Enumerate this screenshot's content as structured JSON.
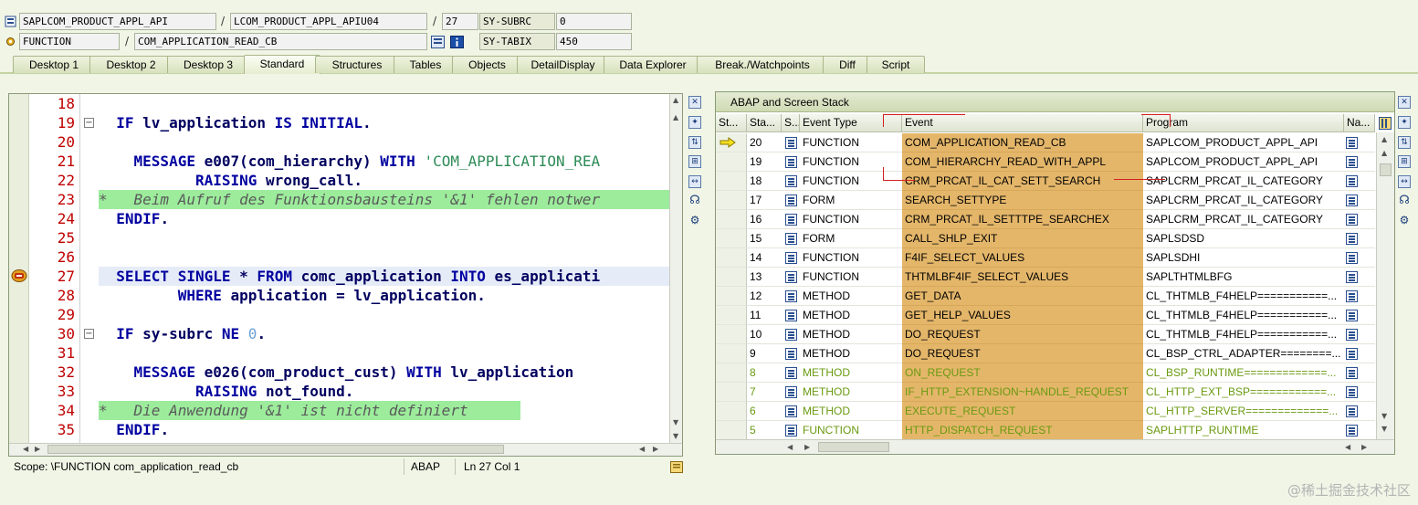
{
  "header": {
    "program": "SAPLCOM_PRODUCT_APPL_API",
    "include": "LCOM_PRODUCT_APPL_APIU04",
    "line": "27",
    "subrc_label": "SY-SUBRC",
    "subrc_value": "0",
    "event_type": "FUNCTION",
    "event": "COM_APPLICATION_READ_CB",
    "tabix_label": "SY-TABIX",
    "tabix_value": "450",
    "slash": "/"
  },
  "tabs": [
    "Desktop 1",
    "Desktop 2",
    "Desktop 3",
    "Standard",
    "Structures",
    "Tables",
    "Objects",
    "DetailDisplay",
    "Data Explorer",
    "Break./Watchpoints",
    "Diff",
    "Script"
  ],
  "active_tab": "Standard",
  "editor": {
    "line_numbers": [
      "18",
      "19",
      "20",
      "21",
      "22",
      "23",
      "24",
      "25",
      "26",
      "27",
      "28",
      "29",
      "30",
      "31",
      "32",
      "33",
      "34",
      "35"
    ],
    "lines": {
      "l19a": "IF",
      "l19b": "lv_application",
      "l19c": "IS INITIAL",
      "l19d": ".",
      "l21a": "MESSAGE",
      "l21b": "e007",
      "l21c": "(com_hierarchy)",
      "l21d": "WITH",
      "l21e": "'COM_APPLICATION_REA",
      "l22a": "RAISING",
      "l22b": "wrong_call",
      "l22c": ".",
      "l23": "*   Beim Aufruf des Funktionsbausteins '&1' fehlen notwer",
      "l24": "ENDIF",
      "l24b": ".",
      "l27a": "SELECT SINGLE",
      "l27b": "*",
      "l27c": "FROM",
      "l27d": "comc_application",
      "l27e": "INTO",
      "l27f": "es_applicati",
      "l28a": "WHERE",
      "l28b": "application",
      "l28c": "=",
      "l28d": "lv_application",
      "l28e": ".",
      "l30a": "IF",
      "l30b": "sy",
      "l30c": "-",
      "l30d": "subrc",
      "l30e": "NE",
      "l30f": "0",
      "l30g": ".",
      "l32a": "MESSAGE",
      "l32b": "e026",
      "l32c": "(com_product_cust)",
      "l32d": "WITH",
      "l32e": "lv_application",
      "l33a": "RAISING",
      "l33b": "not_found",
      "l33c": ".",
      "l34": "*   Die Anwendung '&1' ist nicht definiert",
      "l35": "ENDIF",
      "l35b": "."
    }
  },
  "status_bar": {
    "scope": "Scope: \\FUNCTION com_application_read_cb",
    "language": "ABAP",
    "position": "Ln  27 Col   1"
  },
  "stack": {
    "title": "ABAP and Screen Stack",
    "columns": [
      "St...",
      "Sta...",
      "S...",
      "Event Type",
      "Event",
      "Program",
      "Na..."
    ],
    "rows": [
      {
        "level": "20",
        "type": "FUNCTION",
        "event": "COM_APPLICATION_READ_CB",
        "program": "SAPLCOM_PRODUCT_APPL_API",
        "current": true,
        "dim": false
      },
      {
        "level": "19",
        "type": "FUNCTION",
        "event": "COM_HIERARCHY_READ_WITH_APPL",
        "program": "SAPLCOM_PRODUCT_APPL_API",
        "current": false,
        "dim": false
      },
      {
        "level": "18",
        "type": "FUNCTION",
        "event": "CRM_PRCAT_IL_CAT_SETT_SEARCH",
        "program": "SAPLCRM_PRCAT_IL_CATEGORY",
        "current": false,
        "dim": false
      },
      {
        "level": "17",
        "type": "FORM",
        "event": "SEARCH_SETTYPE",
        "program": "SAPLCRM_PRCAT_IL_CATEGORY",
        "current": false,
        "dim": false
      },
      {
        "level": "16",
        "type": "FUNCTION",
        "event": "CRM_PRCAT_IL_SETTTPE_SEARCHEX",
        "program": "SAPLCRM_PRCAT_IL_CATEGORY",
        "current": false,
        "dim": false
      },
      {
        "level": "15",
        "type": "FORM",
        "event": "CALL_SHLP_EXIT",
        "program": "SAPLSDSD",
        "current": false,
        "dim": false
      },
      {
        "level": "14",
        "type": "FUNCTION",
        "event": "F4IF_SELECT_VALUES",
        "program": "SAPLSDHI",
        "current": false,
        "dim": false
      },
      {
        "level": "13",
        "type": "FUNCTION",
        "event": "THTMLBF4IF_SELECT_VALUES",
        "program": "SAPLTHTMLBFG",
        "current": false,
        "dim": false
      },
      {
        "level": "12",
        "type": "METHOD",
        "event": "GET_DATA",
        "program": "CL_THTMLB_F4HELP===========...",
        "current": false,
        "dim": false
      },
      {
        "level": "11",
        "type": "METHOD",
        "event": "GET_HELP_VALUES",
        "program": "CL_THTMLB_F4HELP===========...",
        "current": false,
        "dim": false
      },
      {
        "level": "10",
        "type": "METHOD",
        "event": "DO_REQUEST",
        "program": "CL_THTMLB_F4HELP===========...",
        "current": false,
        "dim": false
      },
      {
        "level": "9",
        "type": "METHOD",
        "event": "DO_REQUEST",
        "program": "CL_BSP_CTRL_ADAPTER========...",
        "current": false,
        "dim": false
      },
      {
        "level": "8",
        "type": "METHOD",
        "event": "ON_REQUEST",
        "program": "CL_BSP_RUNTIME=============...",
        "current": false,
        "dim": true
      },
      {
        "level": "7",
        "type": "METHOD",
        "event": "IF_HTTP_EXTENSION~HANDLE_REQUEST",
        "program": "CL_HTTP_EXT_BSP============...",
        "current": false,
        "dim": true
      },
      {
        "level": "6",
        "type": "METHOD",
        "event": "EXECUTE_REQUEST",
        "program": "CL_HTTP_SERVER=============...",
        "current": false,
        "dim": true
      },
      {
        "level": "5",
        "type": "FUNCTION",
        "event": "HTTP_DISPATCH_REQUEST",
        "program": "SAPLHTTP_RUNTIME",
        "current": false,
        "dim": true
      }
    ]
  },
  "watermark": "@稀土掘金技术社区",
  "colors": {
    "event_column": "#e4b66a",
    "dim_rows": "#6a9a10",
    "comment_highlight": "#9cec9c",
    "line_numbers": "#c00000"
  }
}
